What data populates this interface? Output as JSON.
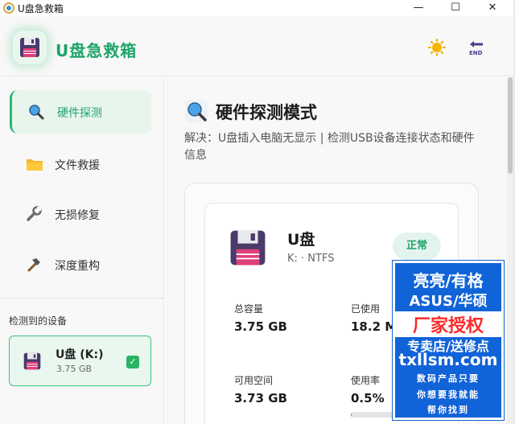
{
  "window": {
    "title": "U盘急救箱",
    "minimize": "—",
    "maximize": "☐",
    "close": "✕"
  },
  "header": {
    "app_name": "U盘急救箱",
    "theme_icon": "sun-icon",
    "exit_icon": "end-icon"
  },
  "sidebar": {
    "items": [
      {
        "label": "硬件探测",
        "icon": "magnifier-icon",
        "active": true
      },
      {
        "label": "文件救援",
        "icon": "folder-icon",
        "active": false
      },
      {
        "label": "无损修复",
        "icon": "wrench-icon",
        "active": false
      },
      {
        "label": "深度重构",
        "icon": "hammer-icon",
        "active": false
      }
    ],
    "devices_title": "检测到的设备",
    "device": {
      "name": "U盘 (K:)",
      "size": "3.75 GB",
      "checked": true
    }
  },
  "main": {
    "title": "硬件探测模式",
    "description": "解决：U盘插入电脑无显示 | 检测USB设备连接状态和硬件信息",
    "disk": {
      "name": "U盘",
      "meta": "K: · NTFS",
      "status": "正常"
    },
    "stats": {
      "total_label": "总容量",
      "total_value": "3.75 GB",
      "used_label": "已使用",
      "used_value": "18.2 MB",
      "free_label": "可用空间",
      "free_value": "3.73 GB",
      "usage_label": "使用率",
      "usage_value": "0.5%",
      "usage_fraction": 0.005
    }
  },
  "promo": {
    "line1": "亮亮/有格",
    "line2": "ASUS/华硕",
    "line3": "厂家授权",
    "line4": "专卖店/送修点",
    "line5": "txllsm.com",
    "line6": "数码产品只要",
    "line7": "你想要我就能",
    "line8": "帮你找到"
  },
  "colors": {
    "accent": "#1fa36a",
    "active_bg": "#e7f5ec",
    "promo_blue": "#1163d8",
    "promo_red": "#ff2a2a"
  }
}
